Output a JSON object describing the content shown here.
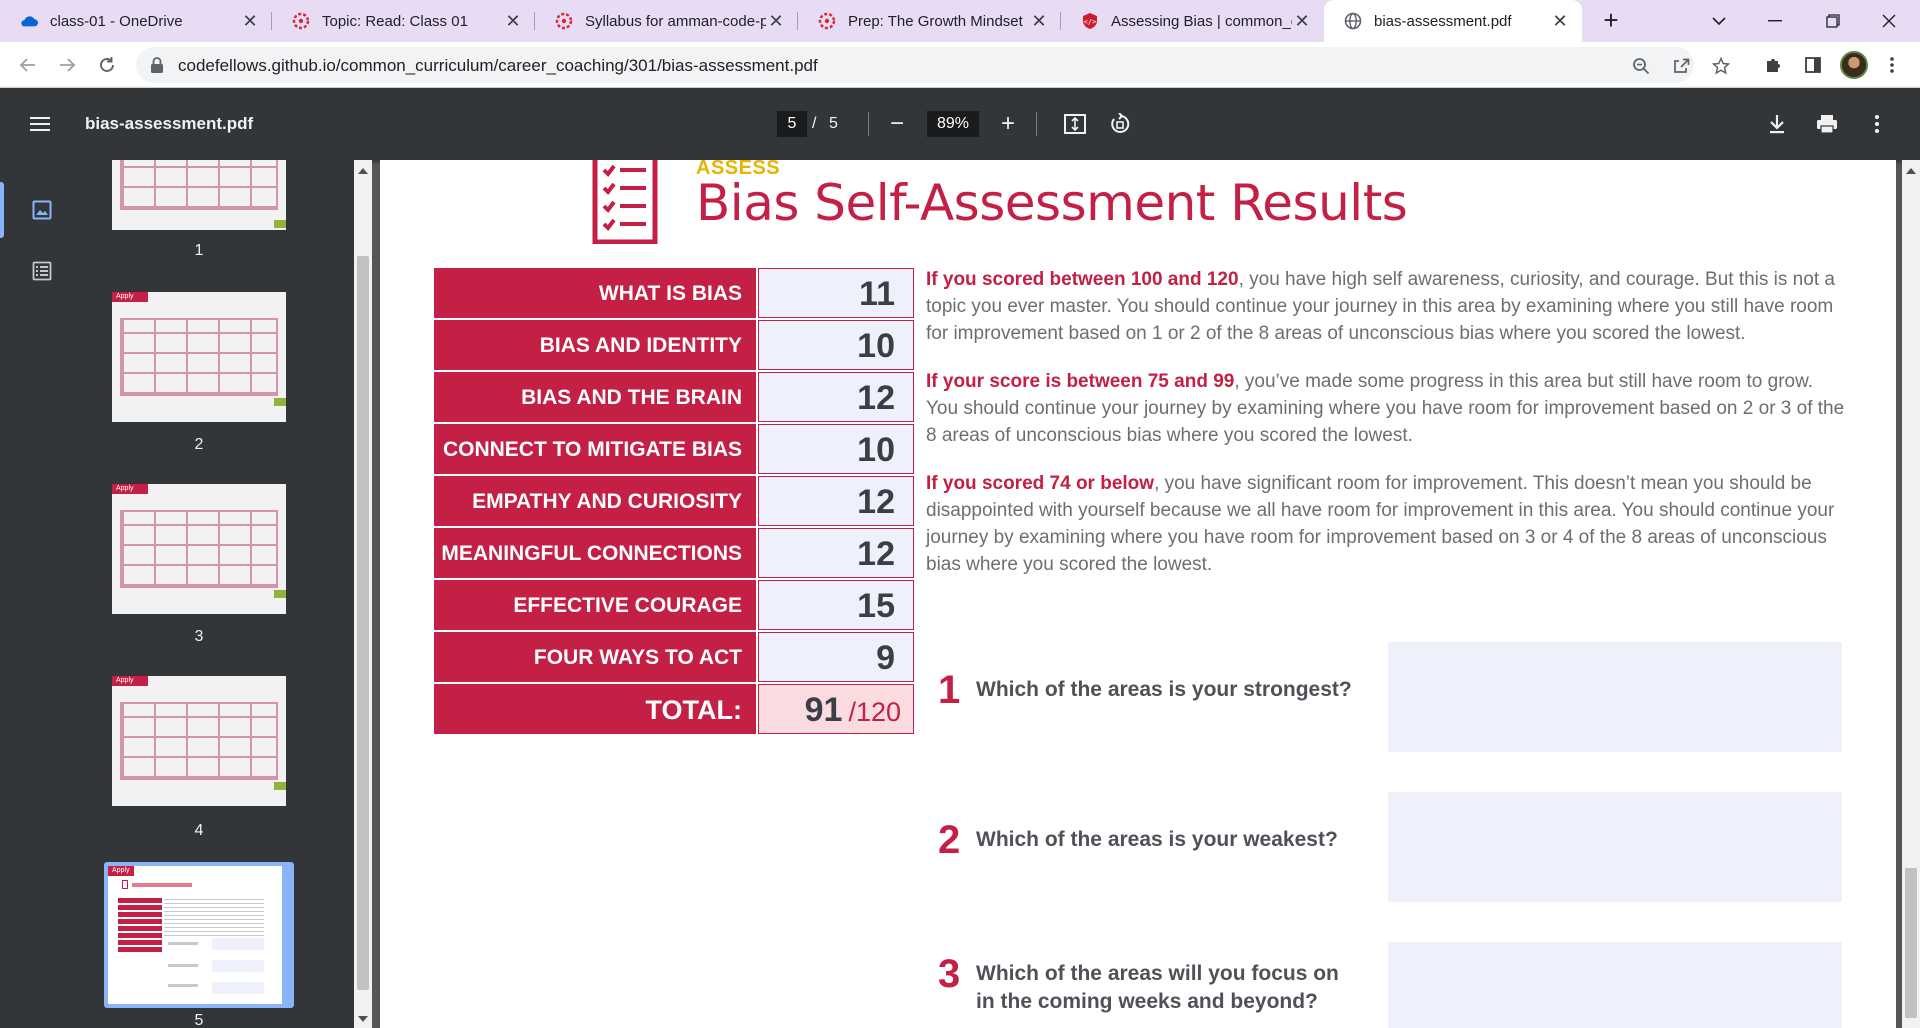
{
  "tabs": [
    {
      "title": "class-01 - OneDrive",
      "favicon": "onedrive-cloud-icon",
      "active": false
    },
    {
      "title": "Topic: Read: Class 01",
      "favicon": "canvas-logo-icon",
      "active": false
    },
    {
      "title": "Syllabus for amman-code-p",
      "favicon": "canvas-logo-icon",
      "active": false
    },
    {
      "title": "Prep: The Growth Mindset",
      "favicon": "canvas-logo-icon",
      "active": false
    },
    {
      "title": "Assessing Bias | common_c",
      "favicon": "shield-code-icon",
      "active": false
    },
    {
      "title": "bias-assessment.pdf",
      "favicon": "globe-icon",
      "active": true
    }
  ],
  "tab_close_glyph": "✕",
  "new_tab_glyph": "+",
  "address_bar": {
    "url": "codefellows.github.io/common_curriculum/career_coaching/301/bias-assessment.pdf"
  },
  "pdf_toolbar": {
    "file_name": "bias-assessment.pdf",
    "current_page": "5",
    "page_separator": "/",
    "total_pages": "5",
    "zoom": "89%",
    "zoom_out_glyph": "−",
    "zoom_in_glyph": "+"
  },
  "sidebar": {
    "thumbnail_labels": [
      "1",
      "2",
      "3",
      "4",
      "5"
    ],
    "thumb_tag": "Apply"
  },
  "document": {
    "section_label": "ASSESS",
    "title": "Bias Self-Assessment Results",
    "scores": [
      {
        "label": "WHAT IS BIAS",
        "value": "11"
      },
      {
        "label": "BIAS AND IDENTITY",
        "value": "10"
      },
      {
        "label": "BIAS AND THE BRAIN",
        "value": "12"
      },
      {
        "label": "CONNECT TO MITIGATE BIAS",
        "value": "10"
      },
      {
        "label": "EMPATHY AND CURIOSITY",
        "value": "12"
      },
      {
        "label": "MEANINGFUL CONNECTIONS",
        "value": "12"
      },
      {
        "label": "EFFECTIVE COURAGE",
        "value": "15"
      },
      {
        "label": "FOUR WAYS TO ACT",
        "value": "9"
      }
    ],
    "total": {
      "label": "TOTAL:",
      "value": "91",
      "max": "/120"
    },
    "paragraphs": [
      {
        "highlight": "If you scored between 100 and 120",
        "text": ", you have high self awareness, curiosity, and courage. But this is not a topic you ever master. You should continue your journey in this area by examining where you still have room for improvement based on 1 or 2 of the 8 areas of unconscious bias where you scored the lowest."
      },
      {
        "highlight": "If your score is between 75 and 99",
        "text": ", you’ve made some progress in this area but still have room to grow. You should continue your journey by examining where you have room for improvement based on 2 or 3 of the 8 areas of unconscious bias where you scored the lowest."
      },
      {
        "highlight": "If you scored 74 or below",
        "text": ", you have significant room for improvement. This doesn’t mean you should be disappointed with yourself because we all have room for improvement in this area. You should continue your journey by examining where you have room for improvement based on 3 or 4 of the 8 areas of unconscious bias where you scored the lowest."
      }
    ],
    "questions": [
      {
        "number": "1",
        "text": "Which of the areas is your strongest?"
      },
      {
        "number": "2",
        "text": "Which of the areas is your weakest?"
      },
      {
        "number": "3",
        "text": "Which of the areas will you focus on in the coming weeks and beyond?"
      }
    ]
  },
  "colors": {
    "brand_red": "#c41f44",
    "accent_yellow": "#e8b400",
    "answer_box": "#eef0fb",
    "tab_strip": "#e8dcf5",
    "viewer_dark": "#323639"
  }
}
